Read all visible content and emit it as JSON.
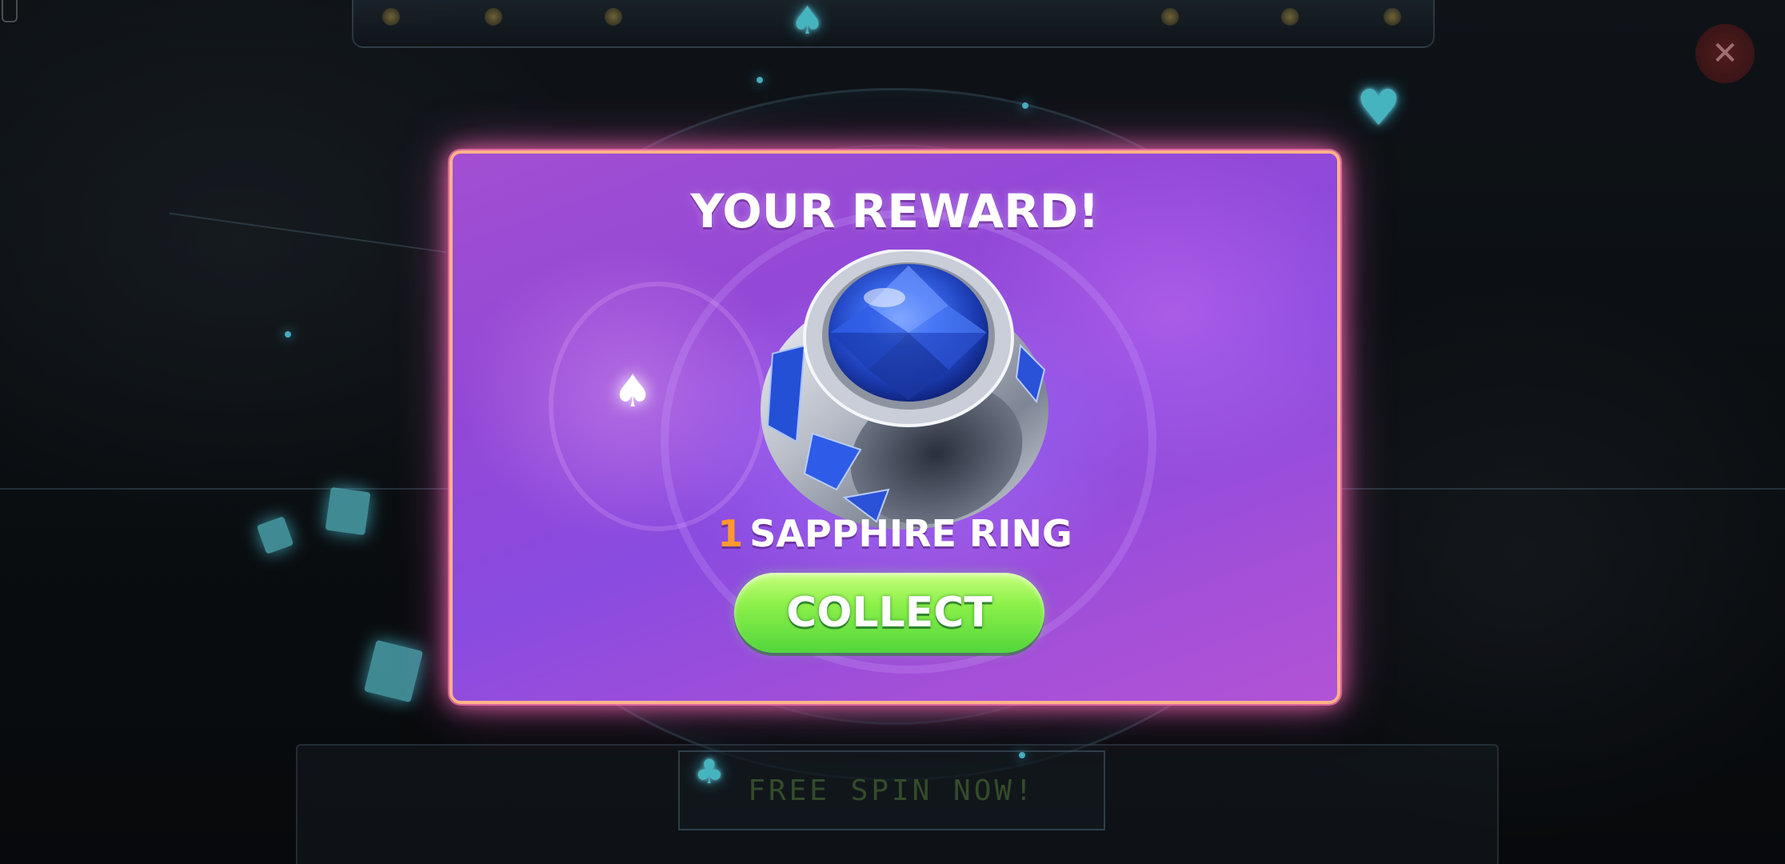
{
  "modal": {
    "title": "YOUR REWARD!",
    "reward_quantity": "1",
    "reward_name": "SAPPHIRE RING",
    "reward_icon": "sapphire-ring-icon",
    "collect_label": "COLLECT"
  },
  "background": {
    "free_spin_label": "FREE SPIN NOW!",
    "close_icon": "close-icon",
    "close_glyph": "✕",
    "suit_spade": "♠",
    "suit_heart": "♥",
    "suit_club": "♣"
  },
  "colors": {
    "modal_purple": "#9348d6",
    "modal_border": "#ffb38a",
    "collect_green": "#8cf04a",
    "quantity_orange": "#ff9a2e",
    "glow_cyan": "#5ef0ff"
  }
}
